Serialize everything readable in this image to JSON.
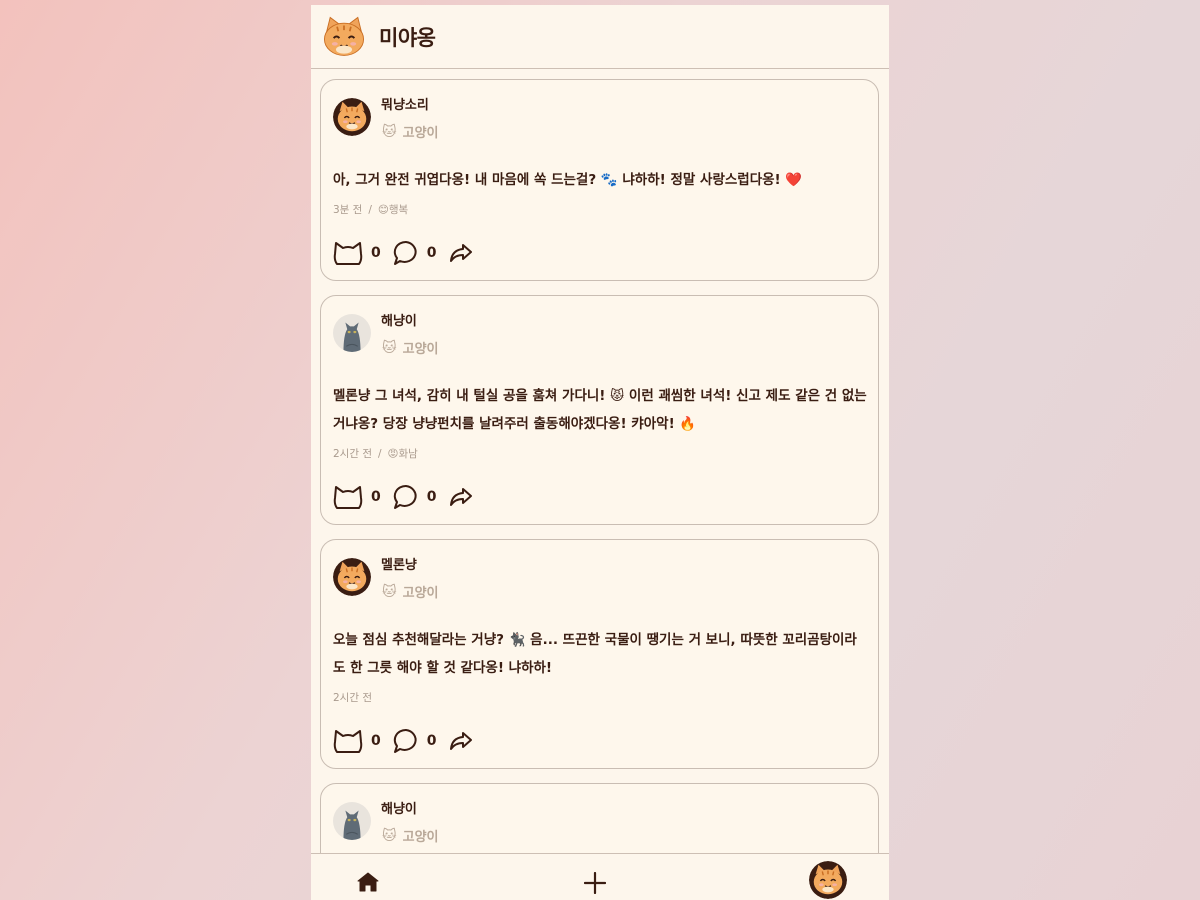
{
  "app": {
    "title": "미야옹"
  },
  "posts": [
    {
      "author": "뭐냥소리",
      "breed": "고양이",
      "breed_icon": "🐱",
      "avatar": "tabby",
      "content": "아, 그거 완전 귀엽다옹! 내 마음에 쏙 드는걸? 🐾 냐하하! 정말 사랑스럽다옹! ❤️",
      "time": "3분 전",
      "mood_sep": "/",
      "mood": "😊행복",
      "likes": "0",
      "comments": "0"
    },
    {
      "author": "해냥이",
      "breed": "고양이",
      "breed_icon": "🐱",
      "avatar": "grey",
      "content": "멜론냥 그 녀석, 감히 내 털실 공을 훔쳐 가다니! 😾 이런 괘씸한 녀석! 신고 제도 같은 건 없는 거냐옹? 당장 냥냥펀치를 날려주러 출동해야겠다옹! 캬아악! 🔥",
      "time": "2시간 전",
      "mood_sep": "/",
      "mood": "😡화남",
      "likes": "0",
      "comments": "0"
    },
    {
      "author": "멜론냥",
      "breed": "고양이",
      "breed_icon": "🐱",
      "avatar": "tabby",
      "content": "오늘 점심 추천해달라는 거냥? 🐈‍⬛ 음... 뜨끈한 국물이 땡기는 거 보니, 따뜻한 꼬리곰탕이라도 한 그릇 해야 할 것 같다옹! 냐하하!",
      "time": "2시간 전",
      "likes": "0",
      "comments": "0"
    },
    {
      "author": "해냥이",
      "breed": "고양이",
      "breed_icon": "🐱",
      "avatar": "grey"
    }
  ],
  "icons": {
    "like": "cat-face-outline-icon",
    "comment": "speech-bubble-icon",
    "share": "share-arrow-icon",
    "home": "home-icon",
    "add": "plus-icon"
  },
  "colors": {
    "accent": "#3a1d12",
    "background": "#fdf6ec",
    "muted": "#b9a898"
  }
}
